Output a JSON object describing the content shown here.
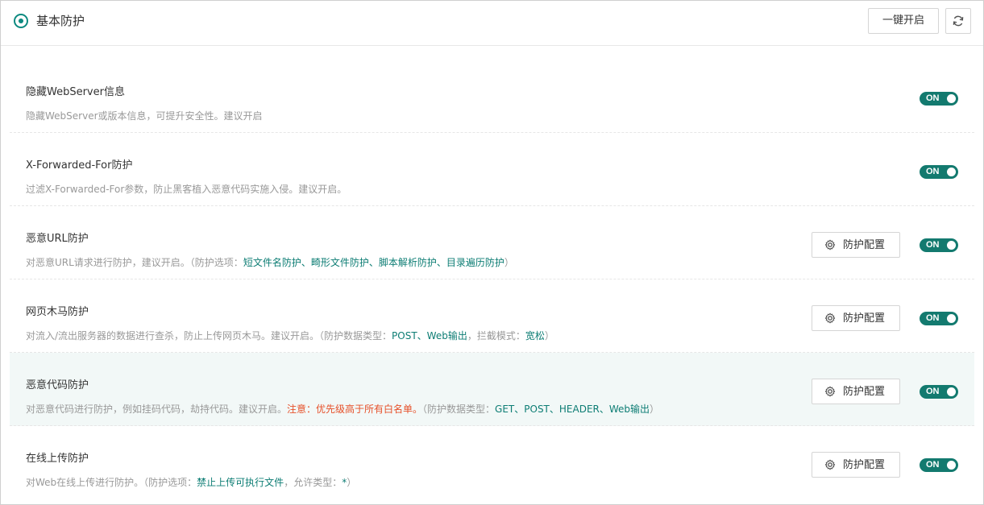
{
  "header": {
    "title": "基本防护",
    "enable_all_label": "一键开启",
    "refresh_icon": "refresh-icon"
  },
  "colors": {
    "accent": "#0d8a80",
    "toggle_on": "#137a6f",
    "warning": "#e6502a",
    "highlight_row": "#f2f8f7"
  },
  "rows": [
    {
      "title": "隐藏WebServer信息",
      "desc": [
        {
          "t": "隐藏WebServer或版本信息，可提升安全性。建议开启",
          "c": ""
        }
      ],
      "has_config": false,
      "toggle": "ON"
    },
    {
      "title": "X-Forwarded-For防护",
      "desc": [
        {
          "t": "过滤X-Forwarded-For参数，防止黑客植入恶意代码实施入侵。建议开启。",
          "c": ""
        }
      ],
      "has_config": false,
      "toggle": "ON"
    },
    {
      "title": "恶意URL防护",
      "desc": [
        {
          "t": "对恶意URL请求进行防护，建议开启。（防护选项：",
          "c": ""
        },
        {
          "t": "短文件名防护、畸形文件防护、脚本解析防护、目录遍历防护",
          "c": "teal"
        },
        {
          "t": "）",
          "c": ""
        }
      ],
      "has_config": true,
      "config_label": "防护配置",
      "toggle": "ON"
    },
    {
      "title": "网页木马防护",
      "desc": [
        {
          "t": "对流入/流出服务器的数据进行查杀，防止上传网页木马。建议开启。（防护数据类型：",
          "c": ""
        },
        {
          "t": "POST、Web输出",
          "c": "teal"
        },
        {
          "t": "，拦截模式：",
          "c": ""
        },
        {
          "t": "宽松",
          "c": "teal"
        },
        {
          "t": "）",
          "c": ""
        }
      ],
      "has_config": true,
      "config_label": "防护配置",
      "toggle": "ON"
    },
    {
      "title": "恶意代码防护",
      "desc": [
        {
          "t": "对恶意代码进行防护，例如挂码代码，劫持代码。建议开启。",
          "c": ""
        },
        {
          "t": "注意：优先级高于所有白名单。",
          "c": "orange"
        },
        {
          "t": "（防护数据类型：",
          "c": ""
        },
        {
          "t": "GET、POST、HEADER、Web输出",
          "c": "teal"
        },
        {
          "t": "）",
          "c": ""
        }
      ],
      "has_config": true,
      "config_label": "防护配置",
      "toggle": "ON",
      "highlight": true
    },
    {
      "title": "在线上传防护",
      "desc": [
        {
          "t": "对Web在线上传进行防护。（防护选项：",
          "c": ""
        },
        {
          "t": "禁止上传可执行文件",
          "c": "teal"
        },
        {
          "t": "，允许类型：",
          "c": ""
        },
        {
          "t": "*",
          "c": "teal"
        },
        {
          "t": "）",
          "c": ""
        }
      ],
      "has_config": true,
      "config_label": "防护配置",
      "toggle": "ON"
    }
  ]
}
